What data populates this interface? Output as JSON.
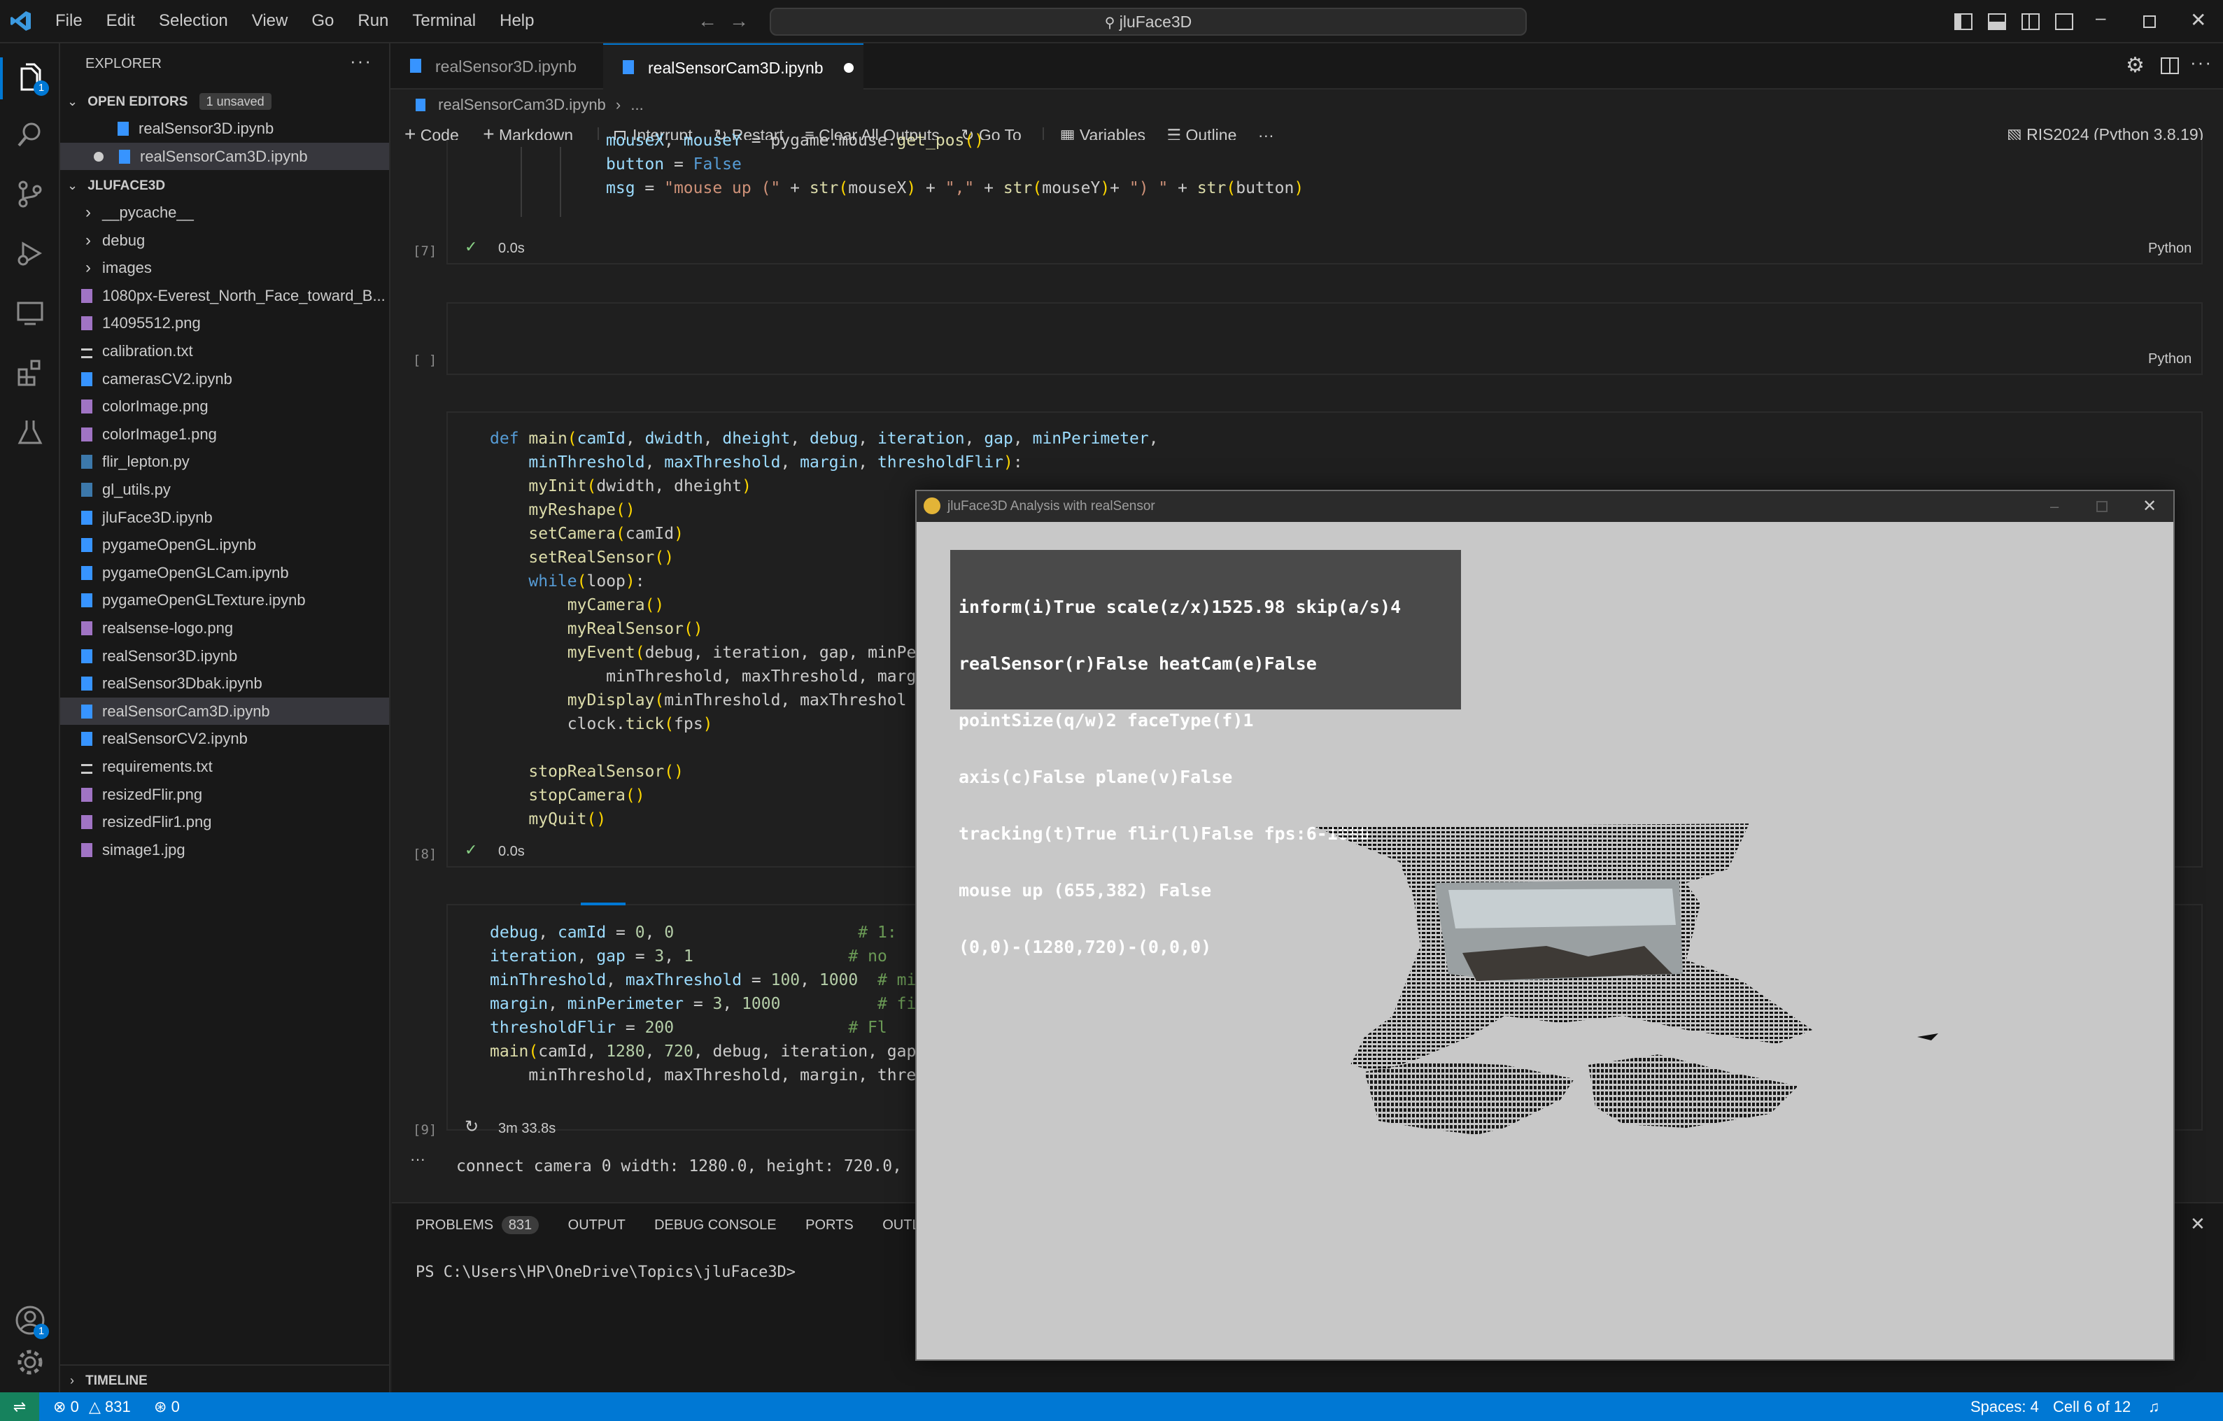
{
  "titlebar": {
    "menu": [
      "File",
      "Edit",
      "Selection",
      "View",
      "Go",
      "Run",
      "Terminal",
      "Help"
    ],
    "search": "jluFace3D"
  },
  "activity": {
    "explorer_badge": "1",
    "accounts_badge": "1"
  },
  "sidebar": {
    "header": "EXPLORER",
    "open_editors_label": "OPEN EDITORS",
    "unsaved_badge": "1 unsaved",
    "open_editors": [
      "realSensor3D.ipynb",
      "realSensorCam3D.ipynb"
    ],
    "project": "JLUFACE3D",
    "folders": [
      "__pycache__",
      "debug",
      "images"
    ],
    "files": [
      {
        "name": "1080px-Everest_North_Face_toward_B...",
        "kind": "image"
      },
      {
        "name": "14095512.png",
        "kind": "image"
      },
      {
        "name": "calibration.txt",
        "kind": "text"
      },
      {
        "name": "camerasCV2.ipynb",
        "kind": "notebook"
      },
      {
        "name": "colorImage.png",
        "kind": "image"
      },
      {
        "name": "colorImage1.png",
        "kind": "image"
      },
      {
        "name": "flir_lepton.py",
        "kind": "python"
      },
      {
        "name": "gl_utils.py",
        "kind": "python"
      },
      {
        "name": "jluFace3D.ipynb",
        "kind": "notebook"
      },
      {
        "name": "pygameOpenGL.ipynb",
        "kind": "notebook"
      },
      {
        "name": "pygameOpenGLCam.ipynb",
        "kind": "notebook"
      },
      {
        "name": "pygameOpenGLTexture.ipynb",
        "kind": "notebook"
      },
      {
        "name": "realsense-logo.png",
        "kind": "image"
      },
      {
        "name": "realSensor3D.ipynb",
        "kind": "notebook"
      },
      {
        "name": "realSensor3Dbak.ipynb",
        "kind": "notebook"
      },
      {
        "name": "realSensorCam3D.ipynb",
        "kind": "notebook"
      },
      {
        "name": "realSensorCV2.ipynb",
        "kind": "notebook"
      },
      {
        "name": "requirements.txt",
        "kind": "text"
      },
      {
        "name": "resizedFlir.png",
        "kind": "image"
      },
      {
        "name": "resizedFlir1.png",
        "kind": "image"
      },
      {
        "name": "simage1.jpg",
        "kind": "image"
      }
    ],
    "timeline": "TIMELINE"
  },
  "tabs": [
    {
      "label": "realSensor3D.ipynb"
    },
    {
      "label": "realSensorCam3D.ipynb"
    }
  ],
  "breadcrumb": {
    "file": "realSensorCam3D.ipynb",
    "more": "..."
  },
  "toolbar": {
    "code": "Code",
    "markdown": "Markdown",
    "interrupt": "Interrupt",
    "restart": "Restart",
    "clear": "Clear All Outputs",
    "goto": "Go To",
    "variables": "Variables",
    "outline": "Outline",
    "kernel": "RIS2024 (Python 3.8.19)"
  },
  "cells": {
    "c7_label": "[7]",
    "c7_time": "0.0s",
    "lang": "Python",
    "c_empty_label": "[ ]",
    "c8_label": "[8]",
    "c8_time": "0.0s",
    "c9_label": "[9]",
    "c9_time": "3m 33.8s",
    "output_line": "connect camera 0 width: 1280.0, height: 720.0, "
  },
  "panel": {
    "tabs": [
      "PROBLEMS",
      "OUTPUT",
      "DEBUG CONSOLE",
      "PORTS",
      "OUTLINE"
    ],
    "problems_count": "831",
    "prompt": "PS C:\\Users\\HP\\OneDrive\\Topics\\jluFace3D>"
  },
  "pgwindow": {
    "title": "jluFace3D Analysis with realSensor",
    "info": [
      "inform(i)True scale(z/x)1525.98 skip(a/s)4",
      "realSensor(r)False heatCam(e)False",
      "pointSize(q/w)2 faceType(f)1",
      "axis(c)False plane(v)False",
      "tracking(t)True flir(l)False fps:6-1086",
      "mouse up (655,382) False",
      "(0,0)-(1280,720)-(0,0,0)"
    ]
  },
  "status": {
    "errors": "0",
    "warnings": "831",
    "ports": "0",
    "spaces": "Spaces: 4",
    "cell": "Cell 6 of 12"
  },
  "colors": {
    "accent": "#0078d4",
    "keyword": "#569cd6",
    "string": "#ce9178",
    "comment": "#6a9955"
  }
}
